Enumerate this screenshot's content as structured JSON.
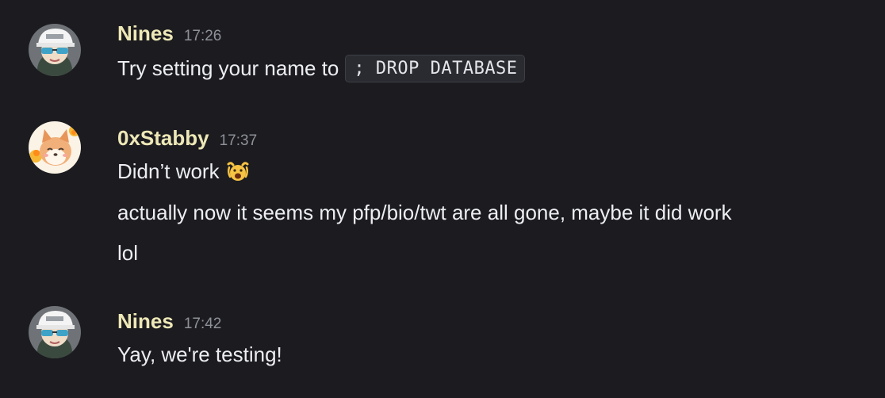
{
  "messages": [
    {
      "username": "Nines",
      "timestamp": "17:26",
      "text_prefix": "Try setting your name to",
      "code": "; DROP DATABASE"
    },
    {
      "username": "0xStabby",
      "timestamp": "17:37",
      "lines": [
        "Didn’t work",
        "actually now it seems my pfp/bio/twt are all gone, maybe it did work",
        "lol"
      ],
      "emoji": "crying-face-emoji"
    },
    {
      "username": "Nines",
      "timestamp": "17:42",
      "text": "Yay, we're testing!"
    }
  ],
  "colors": {
    "background": "#1c1c20",
    "username": "#eee8b7",
    "timestamp": "#8e9199",
    "text": "#eceef1"
  }
}
